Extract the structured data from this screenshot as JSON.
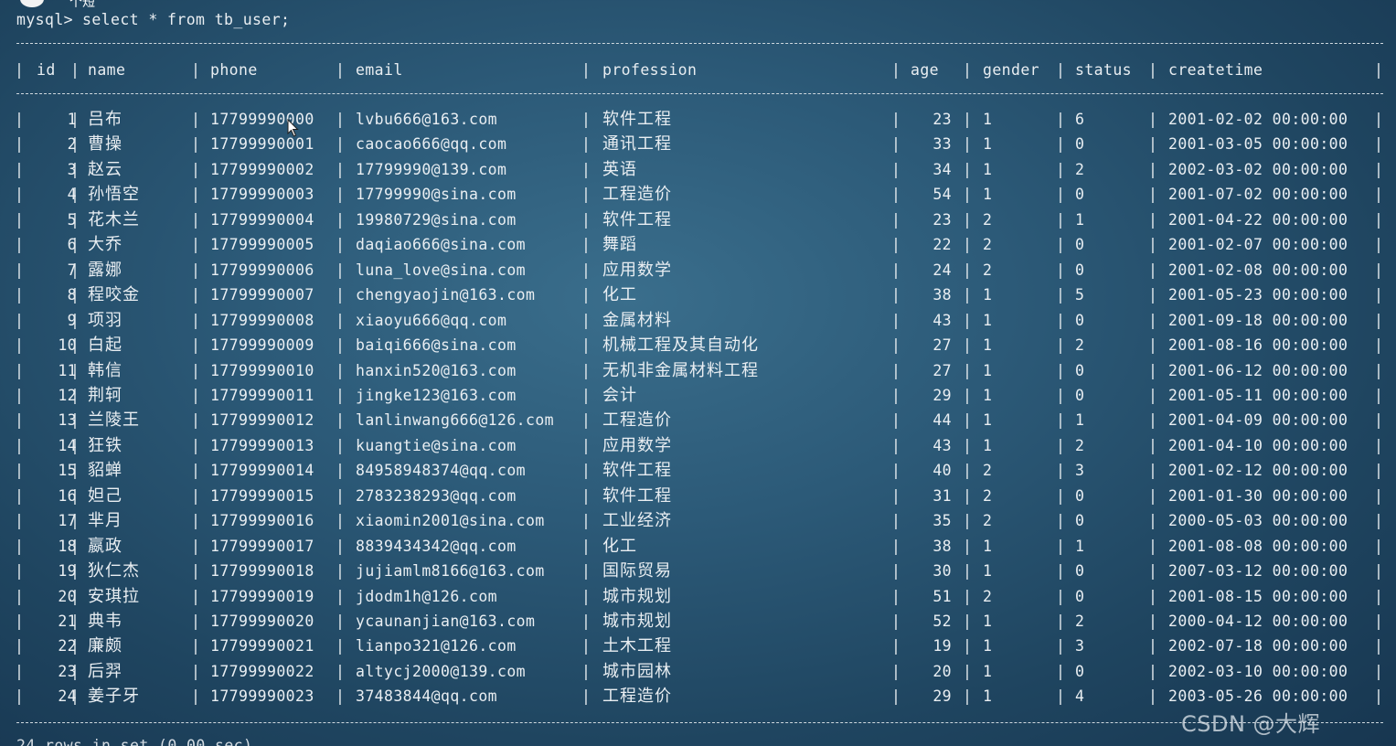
{
  "badge_text": "个短",
  "prompt": "mysql>",
  "command": "select * from tb_user;",
  "columns": [
    "id",
    "name",
    "phone",
    "email",
    "profession",
    "age",
    "gender",
    "status",
    "createtime"
  ],
  "rows": [
    {
      "id": "1",
      "name": "吕布",
      "phone": "17799990000",
      "email": "lvbu666@163.com",
      "profession": "软件工程",
      "age": "23",
      "gender": "1",
      "status": "6",
      "createtime": "2001-02-02 00:00:00"
    },
    {
      "id": "2",
      "name": "曹操",
      "phone": "17799990001",
      "email": "caocao666@qq.com",
      "profession": "通讯工程",
      "age": "33",
      "gender": "1",
      "status": "0",
      "createtime": "2001-03-05 00:00:00"
    },
    {
      "id": "3",
      "name": "赵云",
      "phone": "17799990002",
      "email": "17799990@139.com",
      "profession": "英语",
      "age": "34",
      "gender": "1",
      "status": "2",
      "createtime": "2002-03-02 00:00:00"
    },
    {
      "id": "4",
      "name": "孙悟空",
      "phone": "17799990003",
      "email": "17799990@sina.com",
      "profession": "工程造价",
      "age": "54",
      "gender": "1",
      "status": "0",
      "createtime": "2001-07-02 00:00:00"
    },
    {
      "id": "5",
      "name": "花木兰",
      "phone": "17799990004",
      "email": "19980729@sina.com",
      "profession": "软件工程",
      "age": "23",
      "gender": "2",
      "status": "1",
      "createtime": "2001-04-22 00:00:00"
    },
    {
      "id": "6",
      "name": "大乔",
      "phone": "17799990005",
      "email": "daqiao666@sina.com",
      "profession": "舞蹈",
      "age": "22",
      "gender": "2",
      "status": "0",
      "createtime": "2001-02-07 00:00:00"
    },
    {
      "id": "7",
      "name": "露娜",
      "phone": "17799990006",
      "email": "luna_love@sina.com",
      "profession": "应用数学",
      "age": "24",
      "gender": "2",
      "status": "0",
      "createtime": "2001-02-08 00:00:00"
    },
    {
      "id": "8",
      "name": "程咬金",
      "phone": "17799990007",
      "email": "chengyaojin@163.com",
      "profession": "化工",
      "age": "38",
      "gender": "1",
      "status": "5",
      "createtime": "2001-05-23 00:00:00"
    },
    {
      "id": "9",
      "name": "项羽",
      "phone": "17799990008",
      "email": "xiaoyu666@qq.com",
      "profession": "金属材料",
      "age": "43",
      "gender": "1",
      "status": "0",
      "createtime": "2001-09-18 00:00:00"
    },
    {
      "id": "10",
      "name": "白起",
      "phone": "17799990009",
      "email": "baiqi666@sina.com",
      "profession": "机械工程及其自动化",
      "age": "27",
      "gender": "1",
      "status": "2",
      "createtime": "2001-08-16 00:00:00"
    },
    {
      "id": "11",
      "name": "韩信",
      "phone": "17799990010",
      "email": "hanxin520@163.com",
      "profession": "无机非金属材料工程",
      "age": "27",
      "gender": "1",
      "status": "0",
      "createtime": "2001-06-12 00:00:00"
    },
    {
      "id": "12",
      "name": "荆轲",
      "phone": "17799990011",
      "email": "jingke123@163.com",
      "profession": "会计",
      "age": "29",
      "gender": "1",
      "status": "0",
      "createtime": "2001-05-11 00:00:00"
    },
    {
      "id": "13",
      "name": "兰陵王",
      "phone": "17799990012",
      "email": "lanlinwang666@126.com",
      "profession": "工程造价",
      "age": "44",
      "gender": "1",
      "status": "1",
      "createtime": "2001-04-09 00:00:00"
    },
    {
      "id": "14",
      "name": "狂铁",
      "phone": "17799990013",
      "email": "kuangtie@sina.com",
      "profession": "应用数学",
      "age": "43",
      "gender": "1",
      "status": "2",
      "createtime": "2001-04-10 00:00:00"
    },
    {
      "id": "15",
      "name": "貂蝉",
      "phone": "17799990014",
      "email": "84958948374@qq.com",
      "profession": "软件工程",
      "age": "40",
      "gender": "2",
      "status": "3",
      "createtime": "2001-02-12 00:00:00"
    },
    {
      "id": "16",
      "name": "妲己",
      "phone": "17799990015",
      "email": "2783238293@qq.com",
      "profession": "软件工程",
      "age": "31",
      "gender": "2",
      "status": "0",
      "createtime": "2001-01-30 00:00:00"
    },
    {
      "id": "17",
      "name": "芈月",
      "phone": "17799990016",
      "email": "xiaomin2001@sina.com",
      "profession": "工业经济",
      "age": "35",
      "gender": "2",
      "status": "0",
      "createtime": "2000-05-03 00:00:00"
    },
    {
      "id": "18",
      "name": "嬴政",
      "phone": "17799990017",
      "email": "8839434342@qq.com",
      "profession": "化工",
      "age": "38",
      "gender": "1",
      "status": "1",
      "createtime": "2001-08-08 00:00:00"
    },
    {
      "id": "19",
      "name": "狄仁杰",
      "phone": "17799990018",
      "email": "jujiamlm8166@163.com",
      "profession": "国际贸易",
      "age": "30",
      "gender": "1",
      "status": "0",
      "createtime": "2007-03-12 00:00:00"
    },
    {
      "id": "20",
      "name": "安琪拉",
      "phone": "17799990019",
      "email": "jdodm1h@126.com",
      "profession": "城市规划",
      "age": "51",
      "gender": "2",
      "status": "0",
      "createtime": "2001-08-15 00:00:00"
    },
    {
      "id": "21",
      "name": "典韦",
      "phone": "17799990020",
      "email": "ycaunanjian@163.com",
      "profession": "城市规划",
      "age": "52",
      "gender": "1",
      "status": "2",
      "createtime": "2000-04-12 00:00:00"
    },
    {
      "id": "22",
      "name": "廉颇",
      "phone": "17799990021",
      "email": "lianpo321@126.com",
      "profession": "土木工程",
      "age": "19",
      "gender": "1",
      "status": "3",
      "createtime": "2002-07-18 00:00:00"
    },
    {
      "id": "23",
      "name": "后羿",
      "phone": "17799990022",
      "email": "altycj2000@139.com",
      "profession": "城市园林",
      "age": "20",
      "gender": "1",
      "status": "0",
      "createtime": "2002-03-10 00:00:00"
    },
    {
      "id": "24",
      "name": "姜子牙",
      "phone": "17799990023",
      "email": "37483844@qq.com",
      "profession": "工程造价",
      "age": "29",
      "gender": "1",
      "status": "4",
      "createtime": "2003-05-26 00:00:00"
    }
  ],
  "footer": "24 rows in set (0.00 sec)",
  "watermark": "CSDN @大辉",
  "colors": {
    "background": "#2c5a78",
    "text": "#e9eef2"
  }
}
